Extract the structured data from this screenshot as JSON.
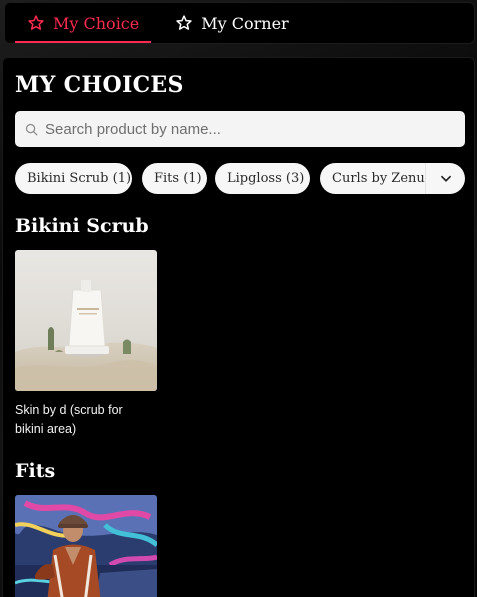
{
  "tabs": [
    {
      "label": "My Choice",
      "active": true,
      "icon": "star-outline-icon"
    },
    {
      "label": "My Corner",
      "active": false,
      "icon": "star-outline-icon"
    }
  ],
  "page": {
    "title": "MY CHOICES"
  },
  "search": {
    "placeholder": "Search product by name...",
    "value": ""
  },
  "filters": {
    "chips": [
      {
        "label": "Bikini Scrub (1)"
      },
      {
        "label": "Fits (1)"
      },
      {
        "label": "Lipgloss (3)"
      },
      {
        "label": "Curls by Zenutr"
      }
    ],
    "toggle_icon": "chevron-down-icon"
  },
  "sections": [
    {
      "title": "Bikini Scrub",
      "products": [
        {
          "name": " Skin by d (scrub for bikini area)"
        }
      ]
    },
    {
      "title": "Fits",
      "products": [
        {
          "name": ""
        }
      ]
    }
  ],
  "colors": {
    "accent": "#ff2a4f",
    "background": "#000000",
    "chip": "#f7f7f7"
  }
}
